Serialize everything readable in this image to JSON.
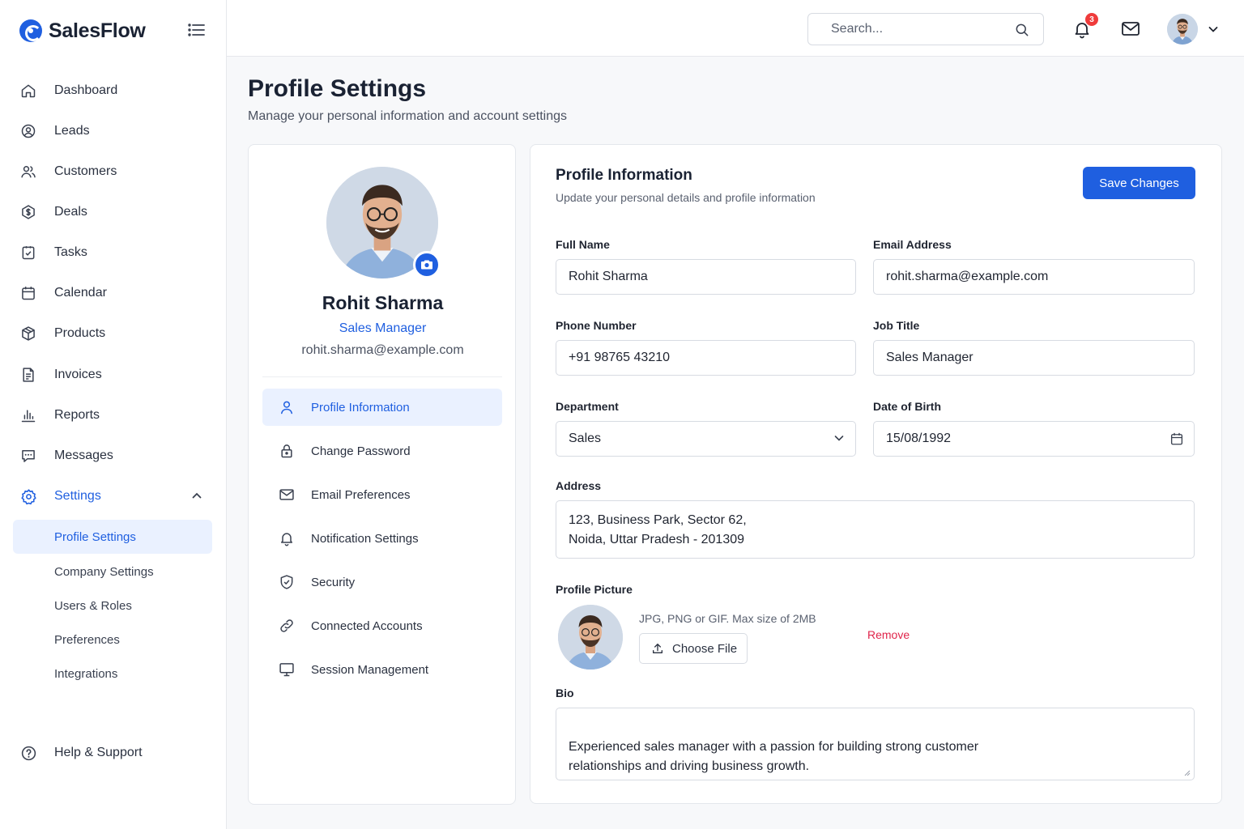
{
  "brand": {
    "name": "SalesFlow"
  },
  "sidebar": {
    "items": [
      {
        "label": "Dashboard",
        "icon": "home-icon"
      },
      {
        "label": "Leads",
        "icon": "leads-icon"
      },
      {
        "label": "Customers",
        "icon": "customers-icon"
      },
      {
        "label": "Deals",
        "icon": "deals-icon"
      },
      {
        "label": "Tasks",
        "icon": "tasks-icon"
      },
      {
        "label": "Calendar",
        "icon": "calendar-icon"
      },
      {
        "label": "Products",
        "icon": "box-icon"
      },
      {
        "label": "Invoices",
        "icon": "invoice-icon"
      },
      {
        "label": "Reports",
        "icon": "bar-chart-icon"
      },
      {
        "label": "Messages",
        "icon": "message-icon"
      },
      {
        "label": "Settings",
        "icon": "gear-icon",
        "expanded": true
      }
    ],
    "sub_items": [
      {
        "label": "Profile Settings",
        "active": true
      },
      {
        "label": "Company Settings"
      },
      {
        "label": "Users & Roles"
      },
      {
        "label": "Preferences"
      },
      {
        "label": "Integrations"
      }
    ],
    "help": {
      "label": "Help & Support",
      "icon": "help-icon"
    }
  },
  "topbar": {
    "search_placeholder": "Search...",
    "notification_count": "3"
  },
  "header": {
    "title": "Profile Settings",
    "subtitle": "Manage your personal information and account settings"
  },
  "profile_card": {
    "name": "Rohit Sharma",
    "role": "Sales Manager",
    "email": "rohit.sharma@example.com",
    "menu": [
      {
        "label": "Profile Information",
        "icon": "user-icon",
        "active": true
      },
      {
        "label": "Change Password",
        "icon": "lock-icon"
      },
      {
        "label": "Email Preferences",
        "icon": "mail-icon"
      },
      {
        "label": "Notification Settings",
        "icon": "bell-icon"
      },
      {
        "label": "Security",
        "icon": "shield-icon"
      },
      {
        "label": "Connected Accounts",
        "icon": "link-icon"
      },
      {
        "label": "Session Management",
        "icon": "monitor-icon"
      }
    ]
  },
  "form": {
    "title": "Profile Information",
    "subtitle": "Update your personal details and profile information",
    "save_label": "Save Changes",
    "full_name": {
      "label": "Full Name",
      "value": "Rohit Sharma"
    },
    "email": {
      "label": "Email Address",
      "value": "rohit.sharma@example.com"
    },
    "phone": {
      "label": "Phone Number",
      "value": "+91 98765 43210"
    },
    "job_title": {
      "label": "Job Title",
      "value": "Sales Manager"
    },
    "department": {
      "label": "Department",
      "value": "Sales"
    },
    "dob": {
      "label": "Date of Birth",
      "value": "15/08/1992"
    },
    "address": {
      "label": "Address",
      "value": "123, Business Park, Sector 62,\nNoida, Uttar Pradesh - 201309"
    },
    "picture": {
      "label": "Profile Picture",
      "hint": "JPG, PNG or GIF. Max size of 2MB",
      "choose_label": "Choose File",
      "remove_label": "Remove"
    },
    "bio": {
      "label": "Bio",
      "value": "Experienced sales manager with a passion for building strong customer\nrelationships and driving business growth."
    }
  },
  "colors": {
    "accent": "#1f5fe0",
    "danger": "#e0244a",
    "badge": "#ef3b3b"
  }
}
